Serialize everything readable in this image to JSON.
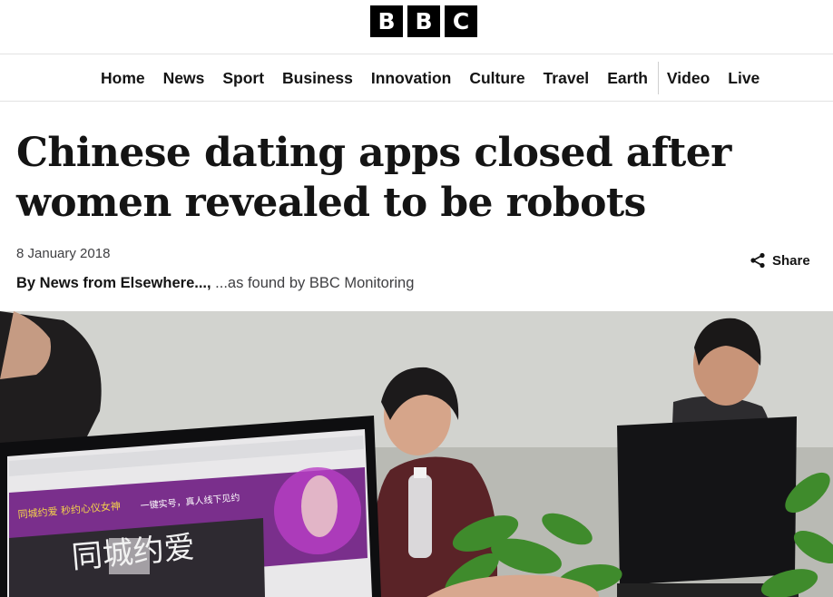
{
  "brand": {
    "letters": [
      "B",
      "B",
      "C"
    ]
  },
  "nav": {
    "items": [
      "Home",
      "News",
      "Sport",
      "Business",
      "Innovation",
      "Culture",
      "Travel",
      "Earth",
      "Video",
      "Live"
    ]
  },
  "article": {
    "headline": "Chinese dating apps closed after women revealed to be robots",
    "date": "8 January 2018",
    "author": "By News from Elsewhere...,",
    "byline_suffix": " ...as found by BBC Monitoring",
    "share_label": "Share"
  },
  "hero_image": {
    "screen_banner_text": "同城约爱 秒约心仪女神",
    "screen_sub_text": "一键实号，真人线下见约",
    "screen_big_text": "同城约爱"
  },
  "colors": {
    "text": "#141414",
    "muted": "#3f3f42",
    "brand": "#000000"
  },
  "icons": {
    "share": "share-icon"
  }
}
